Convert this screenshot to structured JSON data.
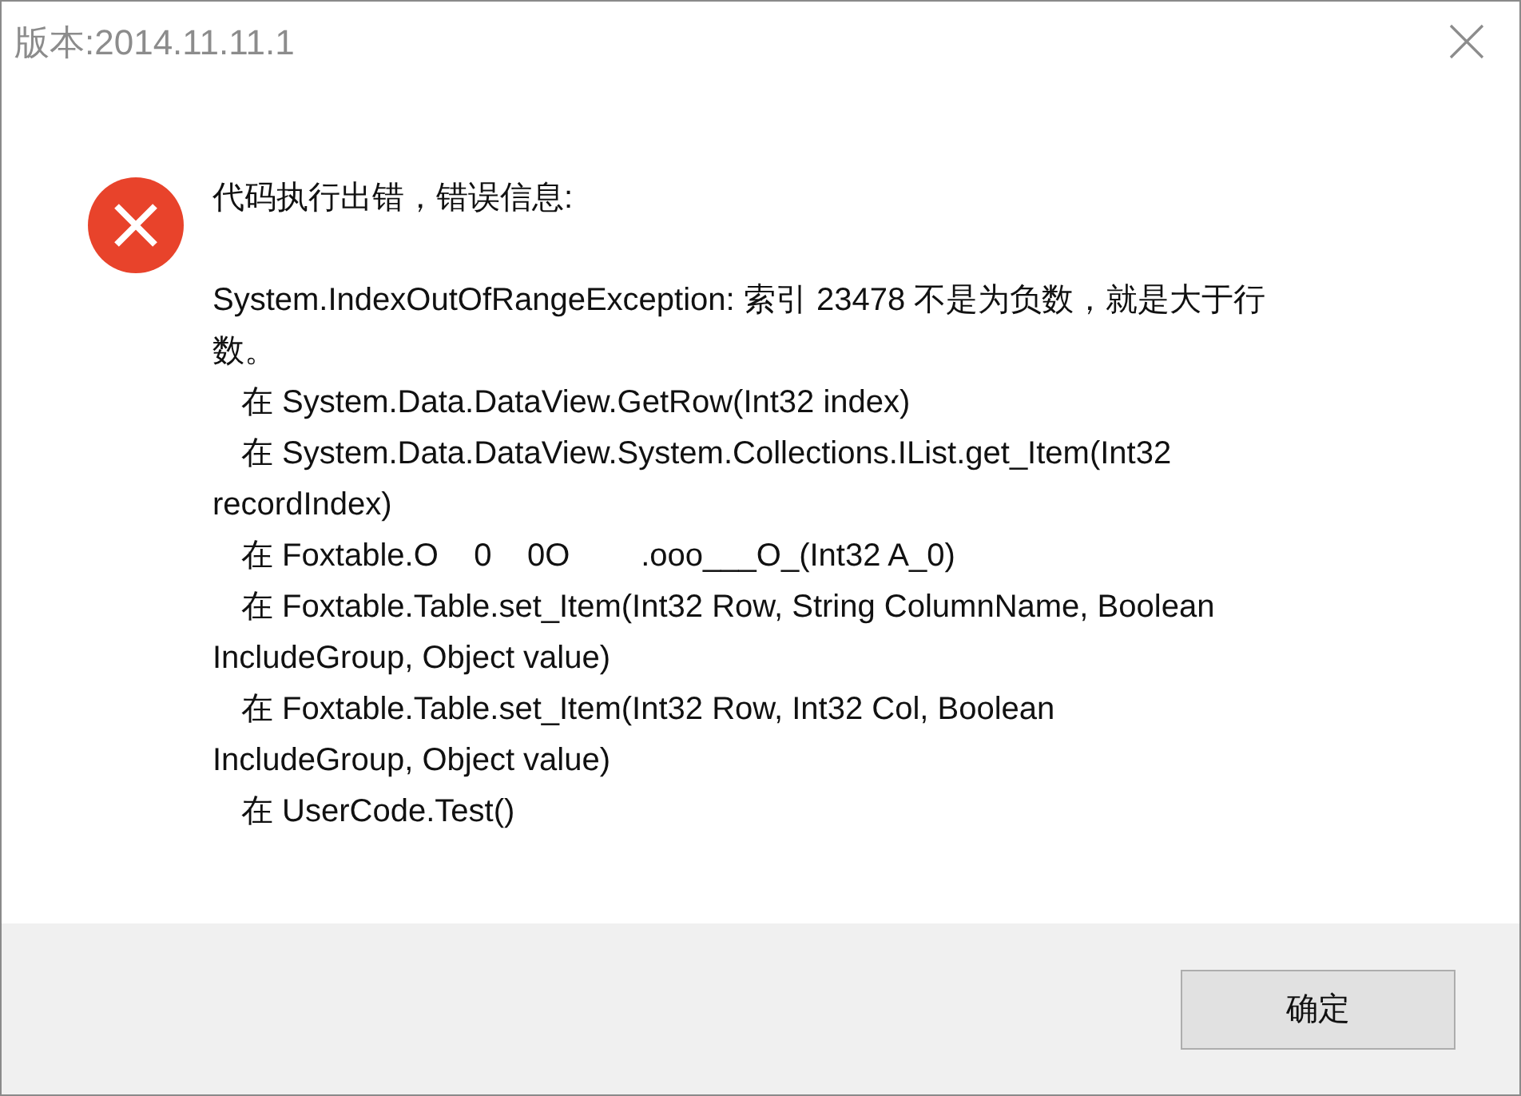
{
  "window": {
    "title": "版本:2014.11.11.1"
  },
  "heading": "代码执行出错，错误信息:",
  "message_lines": [
    {
      "kind": "text",
      "text": "System.IndexOutOfRangeException: 索引 23478 不是为负数，就是大于行"
    },
    {
      "kind": "text",
      "text": "数。"
    },
    {
      "kind": "frame",
      "text": "在 System.Data.DataView.GetRow(Int32 index)"
    },
    {
      "kind": "frame",
      "text": "在 System.Data.DataView.System.Collections.IList.get_Item(Int32"
    },
    {
      "kind": "text",
      "text": "recordIndex)"
    },
    {
      "kind": "frame",
      "text": "在 Foxtable.O    0    0O        .ooo___O_(Int32 A_0)"
    },
    {
      "kind": "frame",
      "text": "在 Foxtable.Table.set_Item(Int32 Row, String ColumnName, Boolean"
    },
    {
      "kind": "text",
      "text": "IncludeGroup, Object value)"
    },
    {
      "kind": "frame",
      "text": "在 Foxtable.Table.set_Item(Int32 Row, Int32 Col, Boolean"
    },
    {
      "kind": "text",
      "text": "IncludeGroup, Object value)"
    },
    {
      "kind": "frame",
      "text": "在 UserCode.Test()"
    }
  ],
  "buttons": [
    "确定"
  ]
}
